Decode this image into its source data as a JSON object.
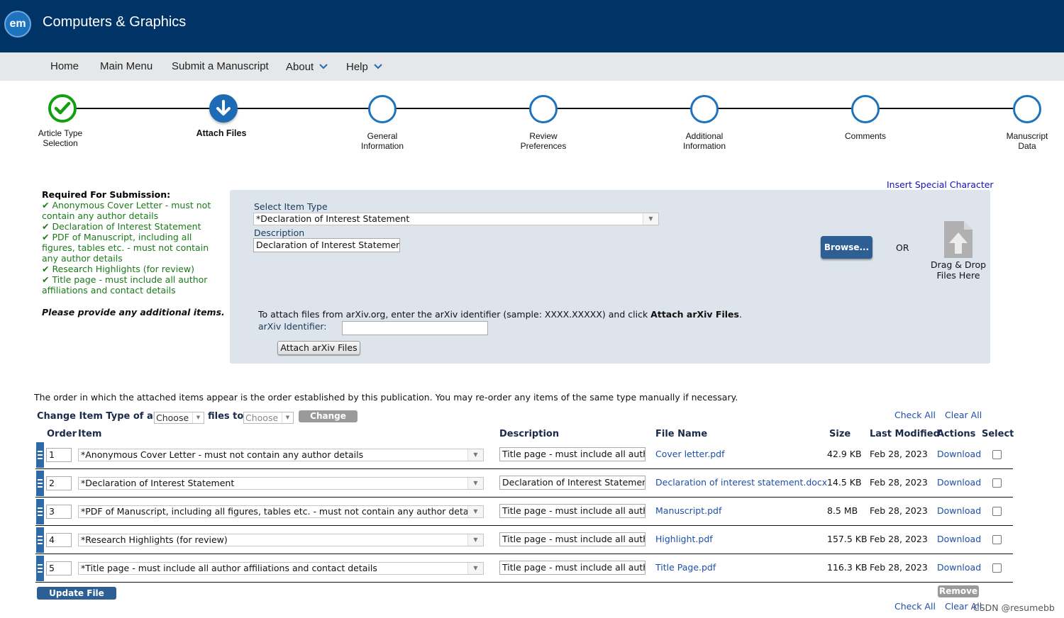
{
  "header": {
    "logo_text": "em",
    "journal_title": "Computers & Graphics"
  },
  "nav": {
    "items": [
      {
        "label": "Home",
        "has_dropdown": false
      },
      {
        "label": "Main Menu",
        "has_dropdown": false
      },
      {
        "label": "Submit a Manuscript",
        "has_dropdown": false
      },
      {
        "label": "About",
        "has_dropdown": true
      },
      {
        "label": "Help",
        "has_dropdown": true
      }
    ]
  },
  "steps": [
    {
      "label_line1": "Article Type",
      "label_line2": "Selection",
      "state": "complete"
    },
    {
      "label_line1": "Attach Files",
      "label_line2": "",
      "state": "current"
    },
    {
      "label_line1": "General",
      "label_line2": "Information",
      "state": "pending"
    },
    {
      "label_line1": "Review",
      "label_line2": "Preferences",
      "state": "pending"
    },
    {
      "label_line1": "Additional",
      "label_line2": "Information",
      "state": "pending"
    },
    {
      "label_line1": "Comments",
      "label_line2": "",
      "state": "pending"
    },
    {
      "label_line1": "Manuscript",
      "label_line2": "Data",
      "state": "pending"
    }
  ],
  "requirements": {
    "title": "Required For Submission:",
    "items": [
      "Anonymous Cover Letter - must not contain any author details",
      "Declaration of Interest Statement",
      "PDF of Manuscript, including all figures, tables etc. - must not contain any author details",
      "Research Highlights (for review)",
      "Title page - must include all author affiliations and contact details"
    ],
    "note": "Please provide any additional items."
  },
  "insert_special_character": "Insert Special Character",
  "upload": {
    "item_type_label": "Select Item Type",
    "item_type_value": "*Declaration of Interest Statement",
    "description_label": "Description",
    "description_value": "Declaration of Interest Statement",
    "browse_label": "Browse...",
    "or_label": "OR",
    "drag_drop_line1": "Drag & Drop",
    "drag_drop_line2": "Files Here",
    "arxiv_text_prefix": "To attach files from arXiv.org, enter the arXiv identifier (sample: XXXX.XXXXX) and click ",
    "arxiv_text_bold": "Attach arXiv Files",
    "arxiv_text_suffix": ".",
    "arxiv_id_label": "arXiv Identifier:",
    "arxiv_id_value": "",
    "attach_arxiv_label": "Attach arXiv Files"
  },
  "order_note": "The order in which the attached items appear is the order established by this publication. You may re-order any items of the same type manually if necessary.",
  "change_type": {
    "label_prefix": "Change Item Type of all",
    "from_value": "Choose",
    "label_mid": "files to",
    "to_value": "Choose",
    "button_label": "Change Now"
  },
  "check_all": "Check All",
  "clear_all": "Clear All",
  "table": {
    "headers": {
      "order": "Order",
      "item": "Item",
      "description": "Description",
      "file_name": "File Name",
      "size": "Size",
      "last_modified": "Last Modified",
      "actions": "Actions",
      "select": "Select"
    },
    "rows": [
      {
        "order": "1",
        "item": "*Anonymous Cover Letter - must not contain any author details",
        "description": "Title page - must include all auth",
        "file_name": "Cover letter.pdf",
        "size": "42.9 KB",
        "modified": "Feb 28, 2023",
        "action": "Download",
        "selected": false
      },
      {
        "order": "2",
        "item": "*Declaration of Interest Statement",
        "description": "Declaration of Interest Statement",
        "file_name": "Declaration of interest statement.docx",
        "size": "14.5 KB",
        "modified": "Feb 28, 2023",
        "action": "Download",
        "selected": false
      },
      {
        "order": "3",
        "item": "*PDF of Manuscript, including all figures, tables etc. - must not contain any author details",
        "description": "Title page - must include all auth",
        "file_name": "Manuscript.pdf",
        "size": "8.5 MB",
        "modified": "Feb 28, 2023",
        "action": "Download",
        "selected": false
      },
      {
        "order": "4",
        "item": "*Research Highlights (for review)",
        "description": "Title page - must include all auth",
        "file_name": "Highlight.pdf",
        "size": "157.5 KB",
        "modified": "Feb 28, 2023",
        "action": "Download",
        "selected": false
      },
      {
        "order": "5",
        "item": "*Title page - must include all author affiliations and contact details",
        "description": "Title page - must include all auth",
        "file_name": "Title Page.pdf",
        "size": "116.3 KB",
        "modified": "Feb 28, 2023",
        "action": "Download",
        "selected": false
      }
    ]
  },
  "update_order_label": "Update File Order",
  "remove_label": "Remove",
  "watermark": "CSDN @resumebb",
  "colors": {
    "header_bg": "#003366",
    "nav_bg": "#e6e7e8",
    "accent": "#1e73be",
    "complete": "#10a010",
    "link": "#1d4fa8",
    "required_text": "#1a7a1a"
  }
}
